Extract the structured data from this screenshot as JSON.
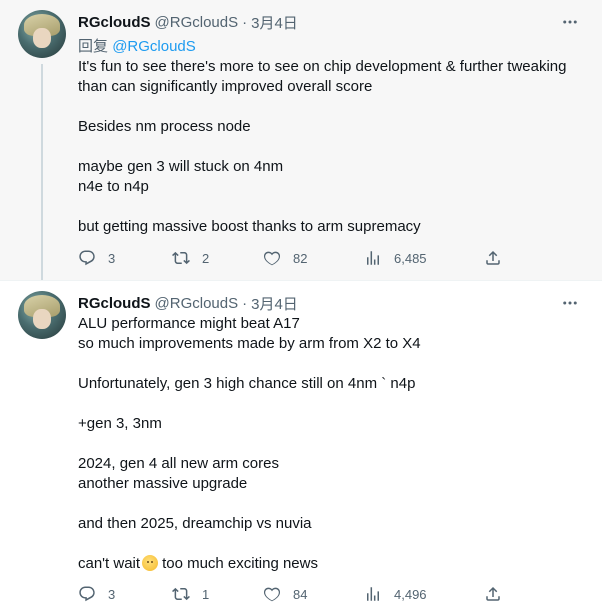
{
  "tweets": [
    {
      "author": {
        "name": "RGcloudS",
        "handle": "@RGcloudS",
        "date": "3月4日"
      },
      "reply_to": {
        "prefix": "回复",
        "mention": "@RGcloudS"
      },
      "text": "It's fun to see there's more to see on chip development & further tweaking than can significantly improved overall score\n\nBesides nm process node\n\nmaybe gen 3 will stuck on 4nm\nn4e to n4p\n\nbut getting massive boost thanks to arm supremacy",
      "stats": {
        "replies": "3",
        "retweets": "2",
        "likes": "82",
        "views": "6,485"
      }
    },
    {
      "author": {
        "name": "RGcloudS",
        "handle": "@RGcloudS",
        "date": "3月4日"
      },
      "text": "ALU performance might beat A17\nso much improvements made by arm from X2 to X4\n\nUnfortunately, gen 3 high chance still on 4nm ` n4p\n\n+gen 3, 3nm\n\n2024, gen 4 all new arm cores\nanother massive upgrade\n\nand then 2025, dreamchip vs nuvia\n\n",
      "text_last_before": "can't wait",
      "text_last_after": "too much exciting news",
      "stats": {
        "replies": "3",
        "retweets": "1",
        "likes": "84",
        "views": "4,496"
      }
    }
  ],
  "separator": "·",
  "icons": {
    "more": "more-horizontal-icon",
    "reply": "reply-bubble-icon",
    "retweet": "retweet-icon",
    "like": "heart-icon",
    "views": "views-bar-chart-icon",
    "share": "share-upload-icon",
    "emoji": "hugging-face-emoji"
  },
  "colors": {
    "link": "#1d9bf0",
    "secondary": "#536471",
    "thread_line": "#cfd9de",
    "highlight_bg": "#f7f7f7"
  }
}
